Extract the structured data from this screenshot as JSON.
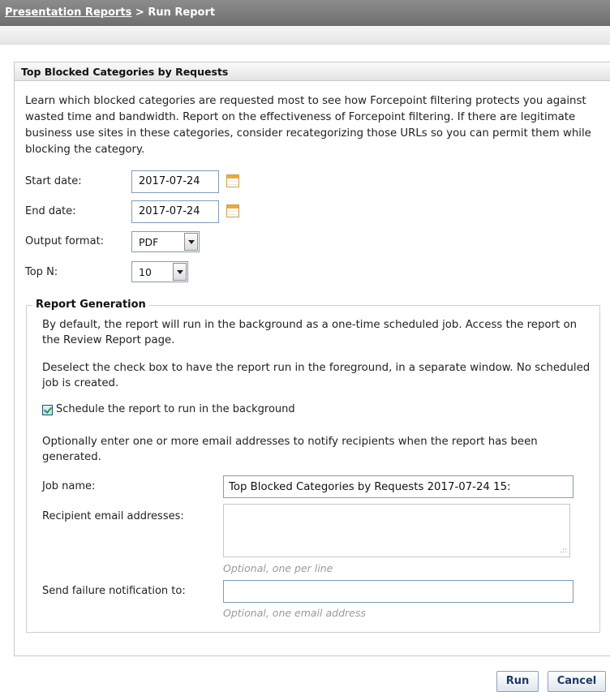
{
  "breadcrumb": {
    "link": "Presentation Reports",
    "separator": " > ",
    "current": "Run Report"
  },
  "panel": {
    "title": "Top Blocked Categories by Requests",
    "description": "Learn which blocked categories are requested most to see how Forcepoint filtering protects you against wasted time and bandwidth. Report on the effectiveness of Forcepoint filtering. If there are legitimate business use sites in these categories, consider recategorizing those URLs so you can permit them while blocking the category."
  },
  "form": {
    "start_date": {
      "label": "Start date:",
      "value": "2017-07-24"
    },
    "end_date": {
      "label": "End date:",
      "value": "2017-07-24"
    },
    "output_format": {
      "label": "Output format:",
      "value": "PDF"
    },
    "top_n": {
      "label": "Top N:",
      "value": "10"
    }
  },
  "report_generation": {
    "legend": "Report Generation",
    "para1": "By default, the report will run in the background as a one-time scheduled job. Access the report on the Review Report page.",
    "para2": "Deselect the check box to have the report run in the foreground, in a separate window. No scheduled job is created.",
    "checkbox_label": "Schedule the report to run in the background",
    "checkbox_checked": true,
    "para3": "Optionally enter one or more email addresses to notify recipients when the report has been generated.",
    "job_name": {
      "label": "Job name:",
      "value": "Top Blocked Categories by Requests 2017-07-24 15:"
    },
    "recipients": {
      "label": "Recipient email addresses:",
      "hint": "Optional, one per line"
    },
    "failure": {
      "label": "Send failure notification to:",
      "hint": "Optional, one email address"
    }
  },
  "buttons": {
    "run": "Run",
    "cancel": "Cancel"
  },
  "icons": {
    "calendar": "calendar-icon",
    "dropdown": "chevron-down-icon",
    "resize": "resize-grip-icon"
  },
  "colors": {
    "header_bg": "#7d7d7d",
    "input_border": "#7f9db9",
    "button_text": "#1f3a66"
  }
}
